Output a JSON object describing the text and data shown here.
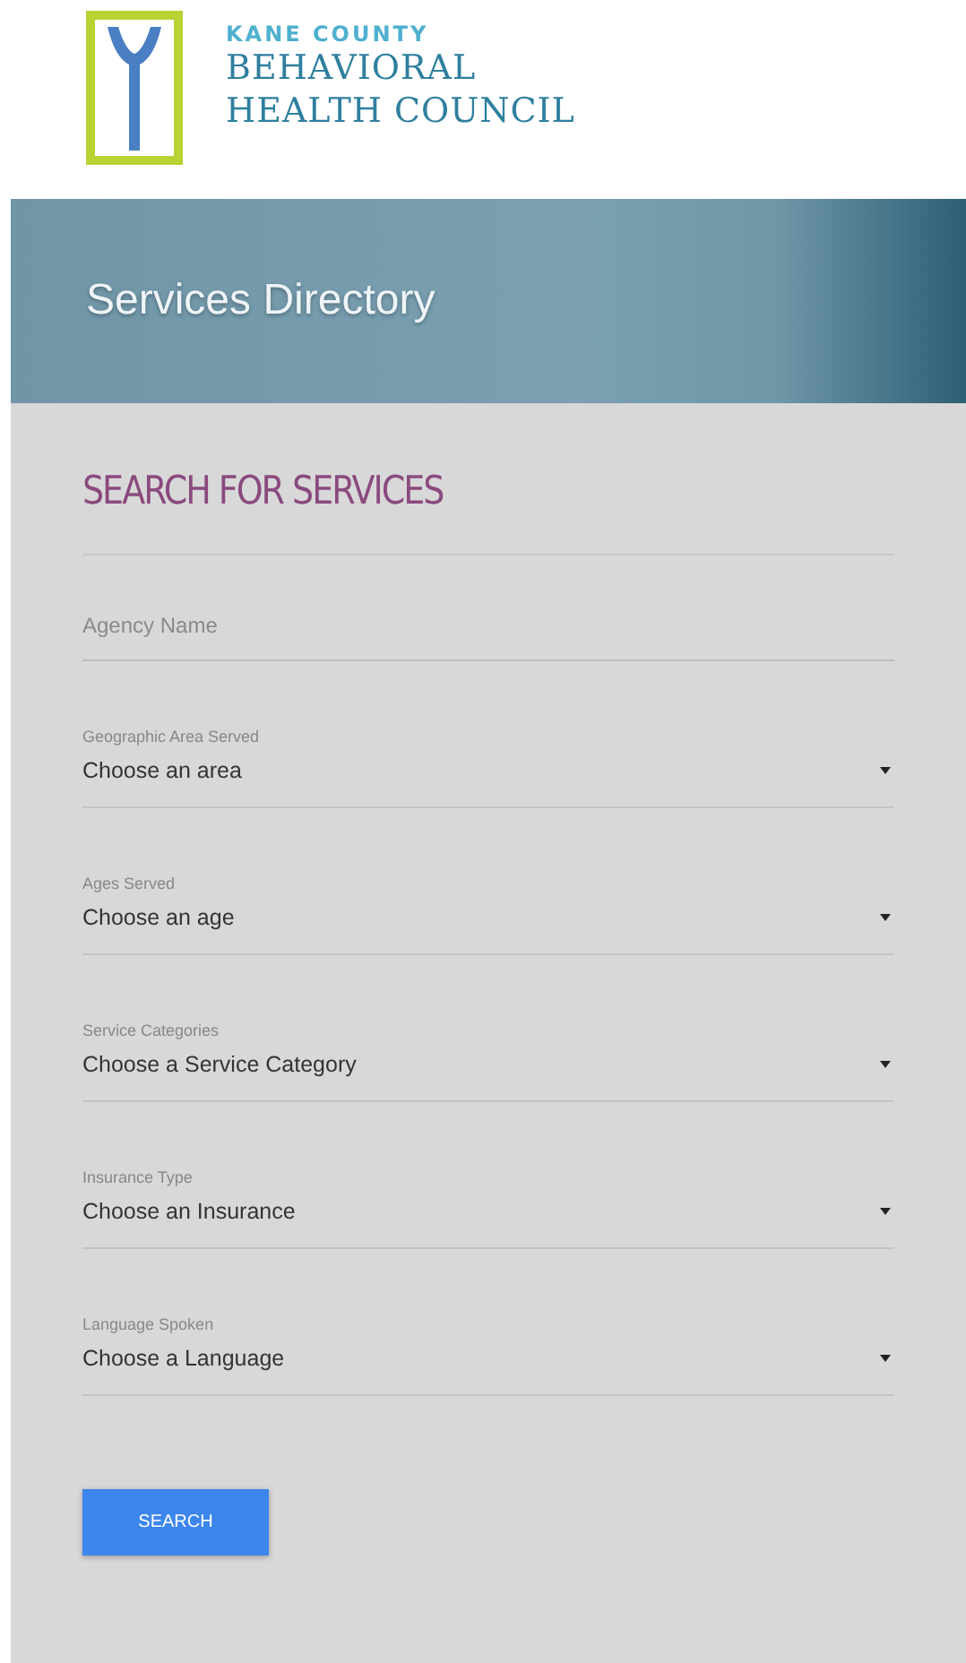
{
  "header": {
    "logo_top": "KANE COUNTY",
    "logo_name_lines": [
      "BEHAVIORAL",
      "HEALTH COUNCIL"
    ]
  },
  "banner": {
    "title": "Services Directory"
  },
  "search": {
    "heading": "SEARCH FOR SERVICES",
    "agency_field": {
      "placeholder": "Agency Name"
    },
    "selects": [
      {
        "label": "Geographic Area Served",
        "value": "Choose an area"
      },
      {
        "label": "Ages Served",
        "value": "Choose an age"
      },
      {
        "label": "Service Categories",
        "value": "Choose a Service Category"
      },
      {
        "label": "Insurance Type",
        "value": "Choose an Insurance"
      },
      {
        "label": "Language Spoken",
        "value": "Choose a Language"
      }
    ],
    "button": "SEARCH"
  }
}
